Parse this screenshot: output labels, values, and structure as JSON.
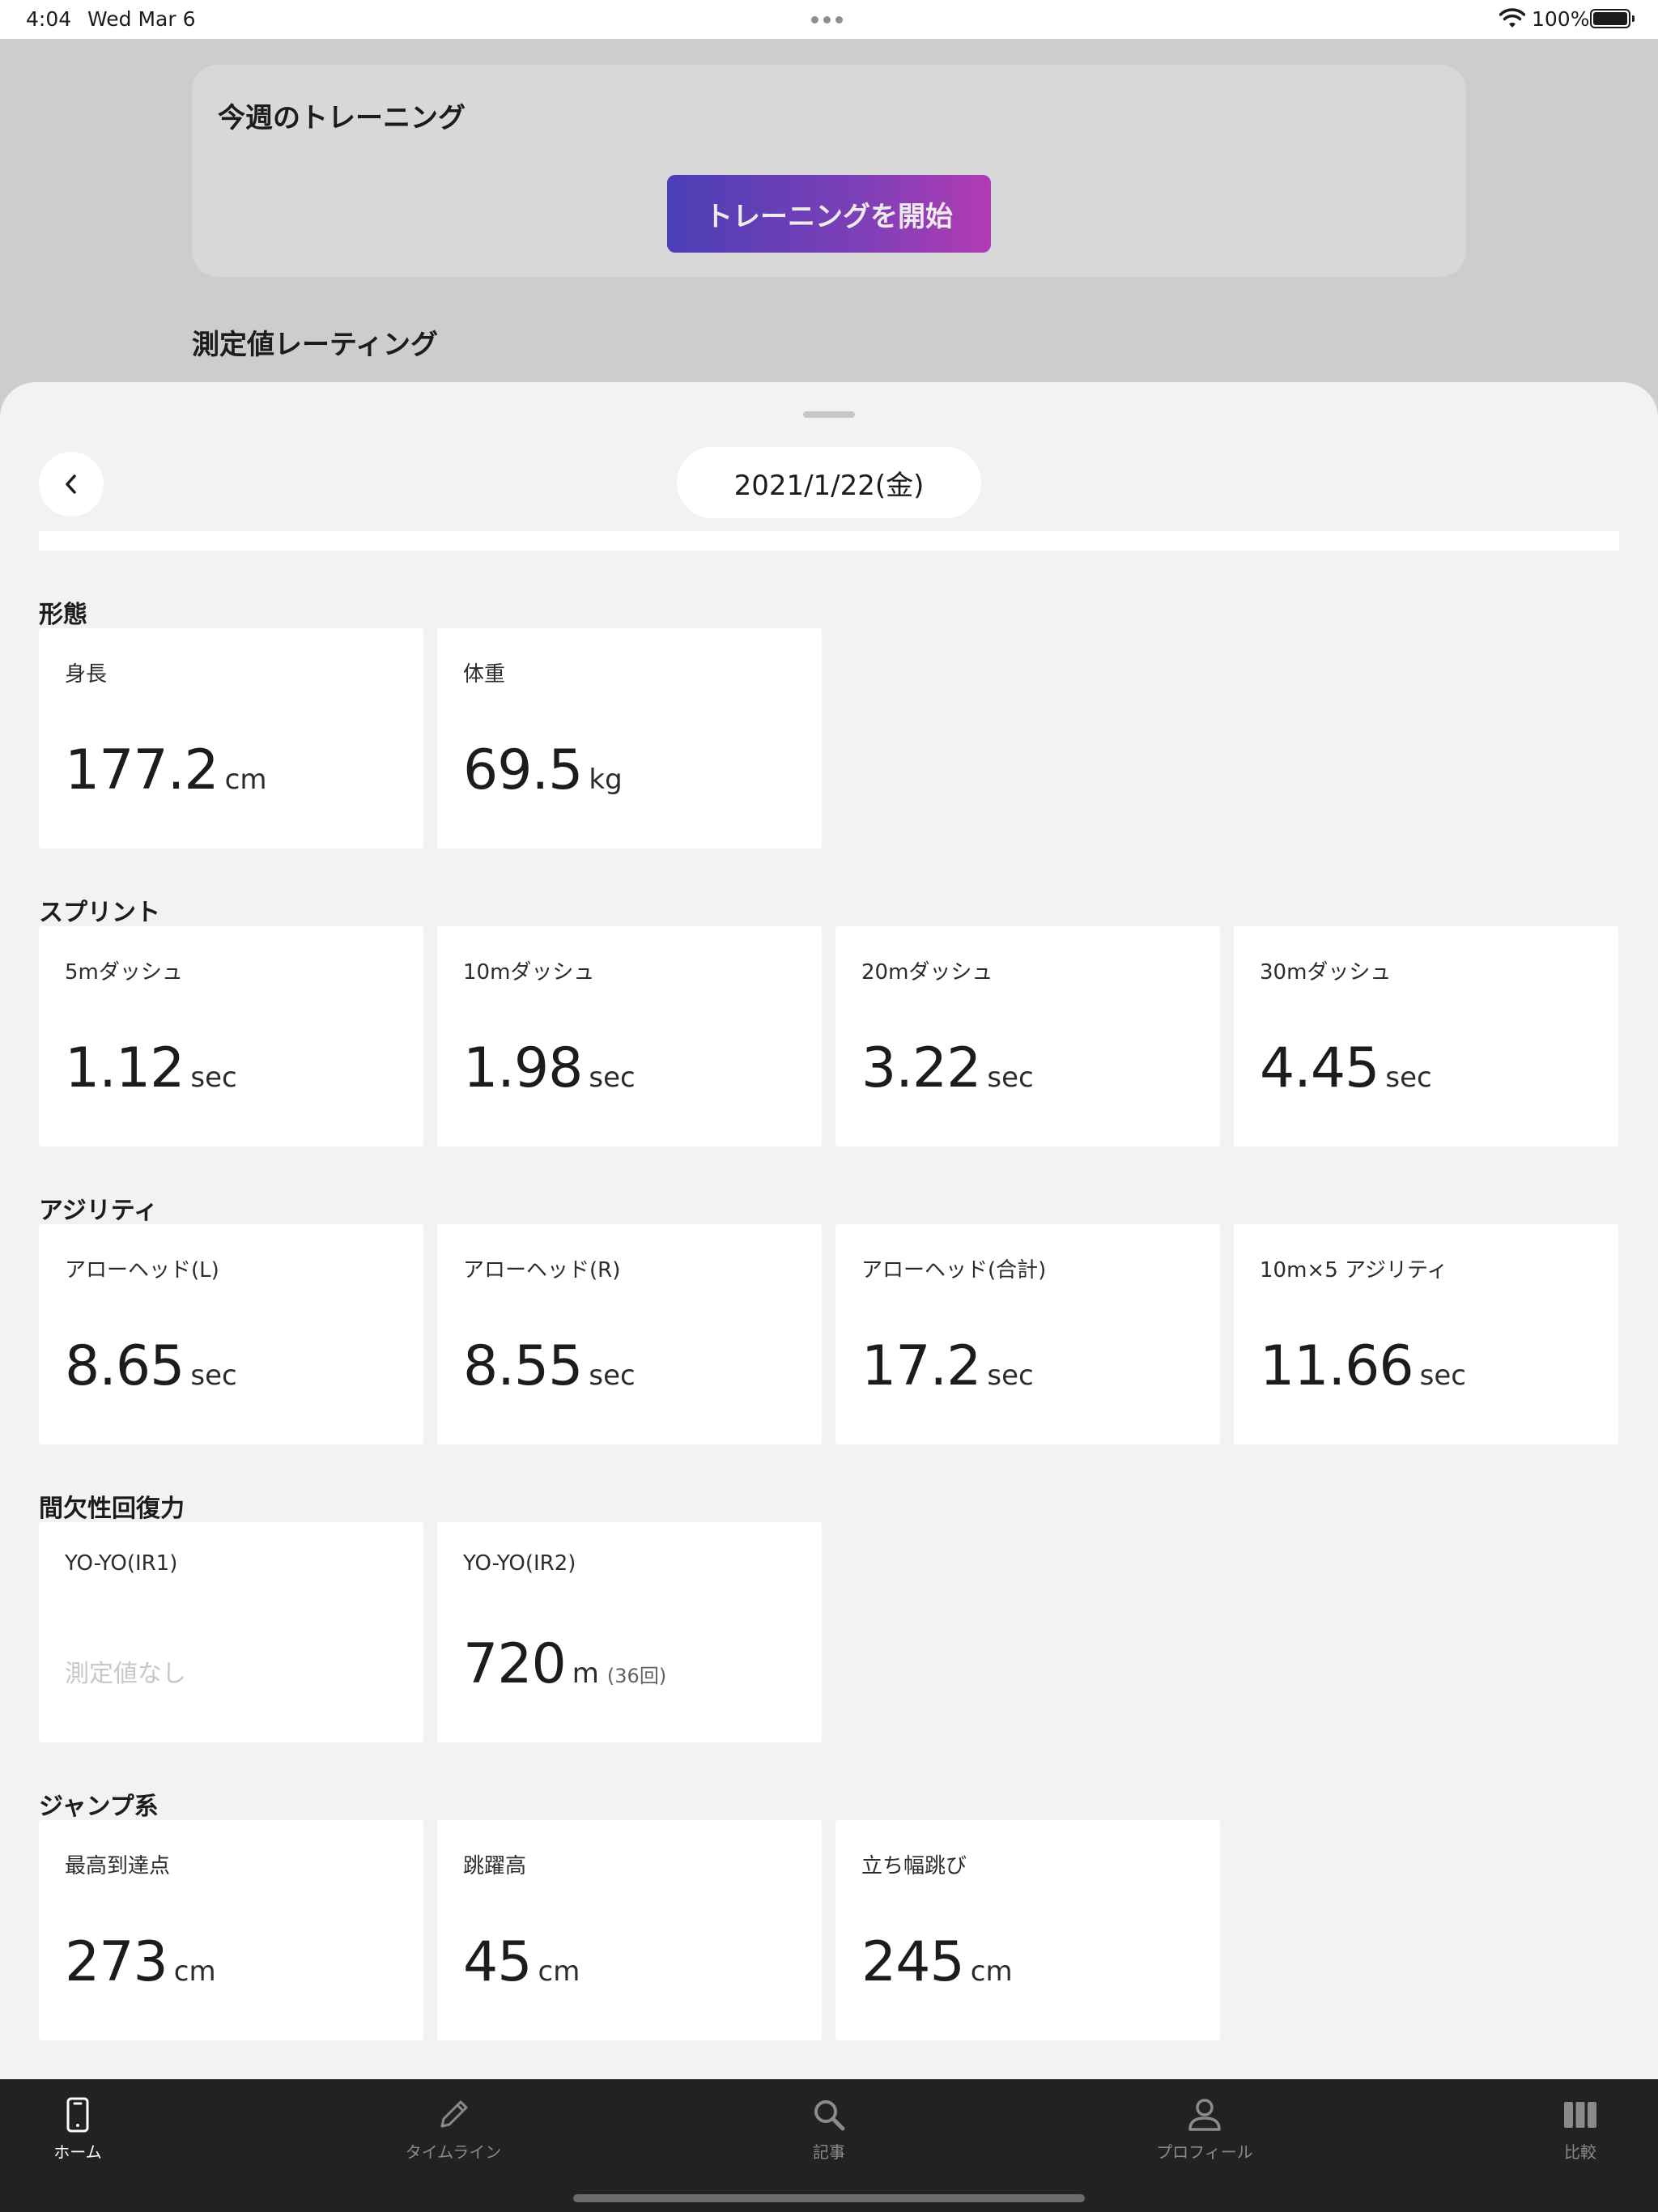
{
  "status_bar": {
    "time": "4:04",
    "date": "Wed Mar 6",
    "battery": "100%"
  },
  "background": {
    "weekly_title": "今週のトレーニング",
    "start_button": "トレーニングを開始",
    "rating_title": "測定値レーティング"
  },
  "sheet": {
    "date": "2021/1/22(金)",
    "sections": [
      {
        "title": "形態",
        "cards": [
          {
            "label": "身長",
            "value": "177.2",
            "unit": "cm"
          },
          {
            "label": "体重",
            "value": "69.5",
            "unit": "kg"
          }
        ]
      },
      {
        "title": "スプリント",
        "cards": [
          {
            "label": "5mダッシュ",
            "value": "1.12",
            "unit": "sec"
          },
          {
            "label": "10mダッシュ",
            "value": "1.98",
            "unit": "sec"
          },
          {
            "label": "20mダッシュ",
            "value": "3.22",
            "unit": "sec"
          },
          {
            "label": "30mダッシュ",
            "value": "4.45",
            "unit": "sec"
          }
        ]
      },
      {
        "title": "アジリティ",
        "cards": [
          {
            "label": "アローヘッド(L)",
            "value": "8.65",
            "unit": "sec"
          },
          {
            "label": "アローヘッド(R)",
            "value": "8.55",
            "unit": "sec"
          },
          {
            "label": "アローヘッド(合計)",
            "value": "17.2",
            "unit": "sec"
          },
          {
            "label": "10m×5 アジリティ",
            "value": "11.66",
            "unit": "sec"
          }
        ]
      },
      {
        "title": "間欠性回復力",
        "cards": [
          {
            "label": "YO-YO(IR1)",
            "empty": "測定値なし"
          },
          {
            "label": "YO-YO(IR2)",
            "value": "720",
            "unit": "m",
            "note": "(36回)"
          }
        ]
      },
      {
        "title": "ジャンプ系",
        "cards": [
          {
            "label": "最高到達点",
            "value": "273",
            "unit": "cm"
          },
          {
            "label": "跳躍高",
            "value": "45",
            "unit": "cm"
          },
          {
            "label": "立ち幅跳び",
            "value": "245",
            "unit": "cm"
          }
        ]
      }
    ]
  },
  "tab_bar": {
    "tabs": [
      {
        "label": "ホーム",
        "icon": "phone-icon",
        "active": true
      },
      {
        "label": "タイムライン",
        "icon": "pencil-icon",
        "active": false
      },
      {
        "label": "記事",
        "icon": "search-icon",
        "active": false
      },
      {
        "label": "プロフィール",
        "icon": "person-icon",
        "active": false
      },
      {
        "label": "比較",
        "icon": "columns-icon",
        "active": false
      }
    ]
  },
  "colors": {
    "accent_gradient_start": "#4a3fb5",
    "accent_gradient_end": "#b13bb4",
    "tab_bar_bg": "#222222",
    "sheet_bg": "#f2f2f2"
  }
}
